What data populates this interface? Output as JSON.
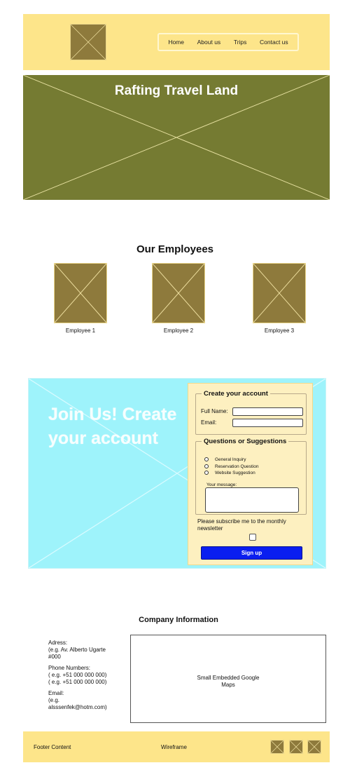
{
  "nav": {
    "items": [
      {
        "label": "Home"
      },
      {
        "label": "About us"
      },
      {
        "label": "Trips"
      },
      {
        "label": "Contact us"
      }
    ]
  },
  "hero": {
    "title": "Rafting Travel Land"
  },
  "employees": {
    "title": "Our Employees",
    "items": [
      {
        "label": "Employee 1"
      },
      {
        "label": "Employee 2"
      },
      {
        "label": "Employee 3"
      }
    ]
  },
  "join": {
    "title": "Join Us! Create your account"
  },
  "form": {
    "account_legend": "Create your account",
    "full_name_label": "Full Name:",
    "email_label": "Email:",
    "questions_legend": "Questions or Suggestions",
    "options": [
      {
        "label": "General Inquiry"
      },
      {
        "label": "Reservation Question"
      },
      {
        "label": "Website Suggestion"
      }
    ],
    "message_label": "Your message:",
    "subscribe_label": "Please subscribe me to the monthly newsletter",
    "signup_label": "Sign up"
  },
  "company": {
    "title": "Company Information",
    "address_label": "Adress:",
    "address_value": "(e.g. Av. Alberto Ugarte #000",
    "phone_label": "Phone Numbers:",
    "phone_1": "( e.g. +51 000 000 000)",
    "phone_2": "( e.g. +51 000 000 000)",
    "email_label": "Email:",
    "email_value": "(e.g. alsssenfek@hotm.com)",
    "map_text": "Small Embedded Google Maps"
  },
  "footer": {
    "content": "Footer Content",
    "center": "Wireframe"
  },
  "colors": {
    "header_bg": "#fde58a",
    "hero_bg": "#757b32",
    "placeholder": "#8e7a3c",
    "join_bg": "#9ef3fb",
    "form_bg": "#fdf0c0",
    "signup_button": "#0a1ef0"
  }
}
